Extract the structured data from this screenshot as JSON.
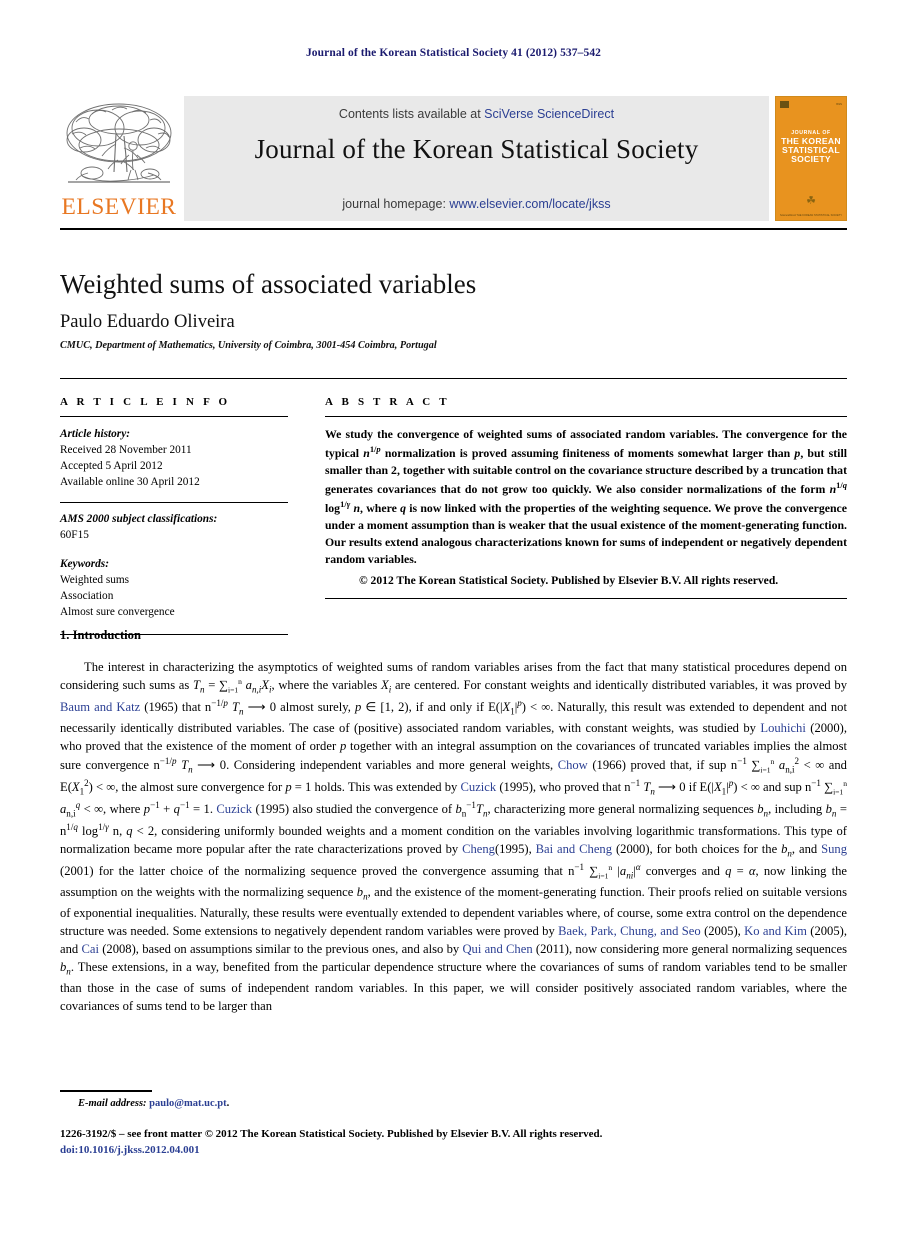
{
  "running_head": "Journal of the Korean Statistical Society 41 (2012) 537–542",
  "masthead": {
    "publisher_name": "ELSEVIER",
    "contents_prefix": "Contents lists available at ",
    "contents_link": "SciVerse ScienceDirect",
    "journal_title": "Journal of the Korean Statistical Society",
    "homepage_prefix": "journal homepage: ",
    "homepage_link": "www.elsevier.com/locate/jkss",
    "cover": {
      "line1": "JOURNAL OF",
      "line2": "THE KOREAN",
      "line3": "STATISTICAL",
      "line4": "SOCIETY"
    },
    "colors": {
      "elsevier_orange": "#e87722",
      "link_blue": "#2b3f93",
      "cover_orange": "#e8931f",
      "panel_gray": "#e9e9e9"
    }
  },
  "article": {
    "title": "Weighted sums of associated variables",
    "author": "Paulo Eduardo Oliveira",
    "affiliation": "CMUC, Department of Mathematics, University of Coimbra, 3001-454 Coimbra, Portugal"
  },
  "info": {
    "heading": "A R T I C L E    I N F O",
    "history_label": "Article history:",
    "history": [
      "Received 28 November 2011",
      "Accepted 5 April 2012",
      "Available online 30 April 2012"
    ],
    "ams_label": "AMS 2000 subject classifications:",
    "ams_values": "60F15",
    "keywords_label": "Keywords:",
    "keywords": [
      "Weighted sums",
      "Association",
      "Almost sure convergence"
    ]
  },
  "abstract": {
    "heading": "A B S T R A C T",
    "copyright": "© 2012 The Korean Statistical Society. Published by Elsevier B.V. All rights reserved."
  },
  "section": {
    "number_title": "1. Introduction"
  },
  "footer": {
    "email_label": "E-mail address:",
    "email": "paulo@mat.uc.pt",
    "email_trail": ".",
    "issn_line": "1226-3192/$ – see front matter © 2012 The Korean Statistical Society. Published by Elsevier B.V. All rights reserved.",
    "doi": "doi:10.1016/j.jkss.2012.04.001"
  },
  "citations": {
    "baum_katz": "Baum and Katz",
    "baum_katz_year": "(1965)",
    "louhichi": "Louhichi",
    "louhichi_year": "(2000)",
    "chow": "Chow",
    "chow_year": "(1966)",
    "cuzick": "Cuzick",
    "cuzick_year": "(1995)",
    "cheng": "Cheng",
    "cheng_year": "(1995)",
    "bai_cheng": "Bai and Cheng",
    "bai_cheng_year": "(2000)",
    "sung": "Sung",
    "sung_year": "(2001)",
    "baek": "Baek, Park, Chung, and Seo",
    "baek_year": "(2005)",
    "ko_kim": "Ko and Kim",
    "ko_kim_year": "(2005)",
    "cai": "Cai",
    "cai_year": "(2008)",
    "qui_chen": "Qui and Chen",
    "qui_chen_year": "(2011)"
  }
}
